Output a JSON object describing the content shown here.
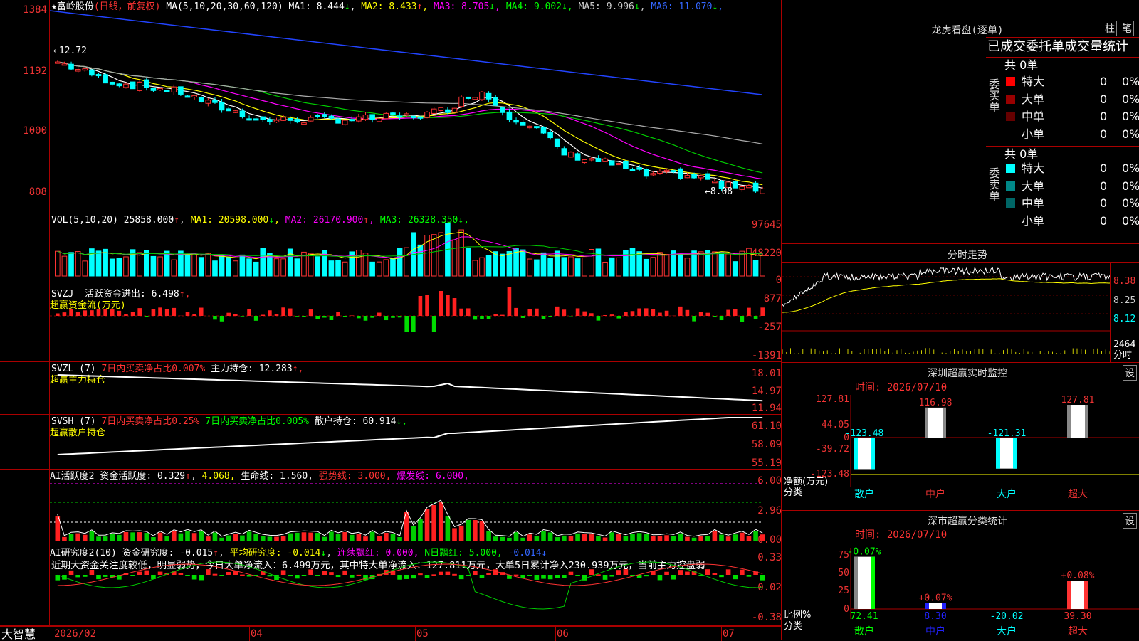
{
  "main": {
    "stock_name": "★富岭股份",
    "period": "(日线，前复权)",
    "ma_header": "MA(5,10,20,30,60,120)",
    "ma": [
      {
        "label": "MA1:",
        "value": "8.444",
        "arrow": "↓",
        "color": "#ffffff"
      },
      {
        "label": "MA2:",
        "value": "8.433",
        "arrow": "↑",
        "color": "#ffff00"
      },
      {
        "label": "MA3:",
        "value": "8.705",
        "arrow": "↓",
        "color": "#ff00ff"
      },
      {
        "label": "MA4:",
        "value": "9.002",
        "arrow": "↓",
        "color": "#00ff00"
      },
      {
        "label": "MA5:",
        "value": "9.996",
        "arrow": "↓",
        "color": "#cccccc"
      },
      {
        "label": "MA6:",
        "value": "11.070",
        "arrow": "↓",
        "color": "#3366ff"
      }
    ],
    "y_ticks": [
      "1384",
      "1192",
      "1000",
      "808"
    ],
    "high_label": "←12.72",
    "low_label": "←8.08"
  },
  "vol": {
    "header": "VOL(5,10,20)",
    "value": "25858.000",
    "ma": [
      {
        "label": "MA1:",
        "value": "20598.000",
        "arrow": "↓",
        "color": "#ffff00"
      },
      {
        "label": "MA2:",
        "value": "26170.900",
        "arrow": "↑",
        "color": "#ff00ff"
      },
      {
        "label": "MA3:",
        "value": "26328.350",
        "arrow": "↓",
        "color": "#00ff00"
      }
    ],
    "y_ticks": [
      "97645",
      "48220",
      "0"
    ]
  },
  "svzj": {
    "header": "SVZJ",
    "label": "活跃资金进出:",
    "value": "6.498",
    "arrow": "↑,",
    "sub": "超赢资金流(万元)",
    "y_ticks": [
      "877",
      "-257",
      "-1391"
    ]
  },
  "svzl": {
    "header": "SVZL (7)",
    "item1": "7日内买卖净占比0.007%",
    "label": "主力持仓:",
    "value": "12.283",
    "arrow": "↑,",
    "sub": "超赢主力持仓",
    "y_ticks": [
      "18.01",
      "14.97",
      "11.94"
    ]
  },
  "svsh": {
    "header": "SVSH (7)",
    "item1": "7日内买卖净占比0.25%",
    "item2": "7日内买卖净占比0.005%",
    "label": "散户持仓:",
    "value": "60.914",
    "arrow": "↓,",
    "sub": "超赢散户持仓",
    "y_ticks": [
      "61.10",
      "58.09",
      "55.19"
    ]
  },
  "ai_active": {
    "header": "AI活跃度2",
    "label": "资金活跃度:",
    "value": "0.329",
    "v2": "4.068,",
    "life_label": "生命线:",
    "life_value": "1.560,",
    "strong": "强势线:",
    "strong_value": "3.000,",
    "burst": "爆发线:",
    "burst_value": "6.000,",
    "y_ticks": [
      "6.00",
      "2.96",
      "0.00"
    ]
  },
  "ai_research": {
    "header": "AI研究度2(10)",
    "label": "资金研究度:",
    "value": "-0.015",
    "avg_label": "平均研究度:",
    "avg_value": "-0.014",
    "red_label": "连续飘红:",
    "red_value": "0.000,",
    "nday_label": "N日飘红:",
    "nday_value": "5.000,",
    "last_value": "-0.014",
    "summary": "近期大资金关注度较低，明显弱势，今日大单净流入：6.499万元，其中特大单净流入：127.811万元，大单5日累计净入230.939万元，当前主力控盘弱",
    "y_ticks": [
      "0.33",
      "-0.02",
      "-0.38"
    ]
  },
  "bottom": {
    "brand": "大智慧",
    "dates": [
      "2026/02",
      "04",
      "05",
      "06",
      "07"
    ]
  },
  "right": {
    "lhb_title": "龙虎看盘(逐单)",
    "btn_zhu": "柱",
    "btn_bi": "笔",
    "stat_title": "已成交委托单成交量统计",
    "buy_side": "委买单",
    "sell_side": "委卖单",
    "total": "共 0单",
    "rows_buy": [
      {
        "name": "特大",
        "count": "0",
        "pct": "0%",
        "color": "#ff0000"
      },
      {
        "name": "大单",
        "count": "0",
        "pct": "0%",
        "color": "#990000"
      },
      {
        "name": "中单",
        "count": "0",
        "pct": "0%",
        "color": "#660000"
      },
      {
        "name": "小单",
        "count": "0",
        "pct": "0%",
        "color": ""
      }
    ],
    "rows_sell": [
      {
        "name": "特大",
        "count": "0",
        "pct": "0%",
        "color": "#00ffff"
      },
      {
        "name": "大单",
        "count": "0",
        "pct": "0%",
        "color": "#008888"
      },
      {
        "name": "中单",
        "count": "0",
        "pct": "0%",
        "color": "#006666"
      },
      {
        "name": "小单",
        "count": "0",
        "pct": "0%",
        "color": ""
      }
    ],
    "minute_title": "分时走势",
    "minute_ticks": [
      "8.38",
      "8.25",
      "8.12"
    ],
    "minute_vol": "2464",
    "minute_vol_label": "分时",
    "sz_title": "深圳超赢实时监控",
    "sz_btn": "设",
    "sz_time": "时间: 2026/07/10",
    "sz_ticks": [
      "127.81",
      "44.05",
      "0",
      "-39.72",
      "-123.48"
    ],
    "sz_ylabel": "净额(万元)",
    "sz_xlabel": "分类",
    "sz_cats": [
      "散户",
      "中户",
      "大户",
      "超大"
    ],
    "sz_values": [
      "-123.48",
      "116.98",
      "-121.31",
      "127.81"
    ],
    "cls_title": "深市超赢分类统计",
    "cls_btn": "设",
    "cls_time": "时间: 2026/07/10",
    "cls_ticks": [
      "75",
      "50",
      "25",
      "0"
    ],
    "cls_ylabel": "比例%",
    "cls_xlabel": "分类",
    "cls_cats": [
      "散户",
      "中户",
      "大户",
      "超大"
    ],
    "cls_values": [
      "72.41",
      "8.30",
      "-20.02",
      "39.30"
    ],
    "cls_changes": [
      "-0.07%",
      "+0.07%",
      "",
      "+0.08%"
    ]
  }
}
